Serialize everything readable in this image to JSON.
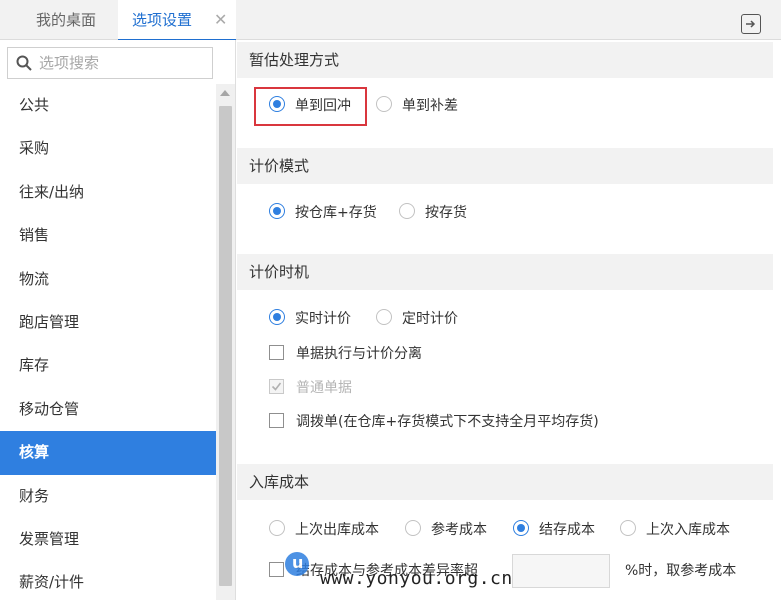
{
  "tabs": [
    {
      "label": "我的桌面"
    },
    {
      "label": "选项设置",
      "close": "✕"
    }
  ],
  "sidebar": {
    "search_placeholder": "选项搜索",
    "items": [
      {
        "label": "公共"
      },
      {
        "label": "采购"
      },
      {
        "label": "往来/出纳"
      },
      {
        "label": "销售"
      },
      {
        "label": "物流"
      },
      {
        "label": "跑店管理"
      },
      {
        "label": "库存"
      },
      {
        "label": "移动仓管"
      },
      {
        "label": "核算",
        "active": true
      },
      {
        "label": "财务"
      },
      {
        "label": "发票管理"
      },
      {
        "label": "薪资/计件"
      }
    ]
  },
  "sections": {
    "estimate": {
      "title": "暂估处理方式",
      "options": [
        {
          "label": "单到回冲",
          "checked": true
        },
        {
          "label": "单到补差",
          "checked": false
        }
      ]
    },
    "pricing_mode": {
      "title": "计价模式",
      "options": [
        {
          "label": "按仓库+存货",
          "checked": true
        },
        {
          "label": "按存货",
          "checked": false
        }
      ]
    },
    "pricing_timing": {
      "title": "计价时机",
      "options": [
        {
          "label": "实时计价",
          "checked": true
        },
        {
          "label": "定时计价",
          "checked": false
        }
      ],
      "checkboxes": [
        {
          "label": "单据执行与计价分离",
          "checked": false
        },
        {
          "label": "普通单据",
          "checked": true,
          "disabled": true
        },
        {
          "label": "调拨单(在仓库+存货模式下不支持全月平均存货)",
          "checked": false
        }
      ]
    },
    "inbound_cost": {
      "title": "入库成本",
      "options": [
        {
          "label": "上次出库成本",
          "checked": false
        },
        {
          "label": "参考成本",
          "checked": false
        },
        {
          "label": "结存成本",
          "checked": true
        },
        {
          "label": "上次入库成本",
          "checked": false
        }
      ],
      "ratio_prefix": "结存成本与参考成本差异率超",
      "ratio_suffix": "%时，取参考成本"
    }
  },
  "watermark": {
    "text": "www.yonyou.org.cn"
  },
  "colors": {
    "accent": "#2f7fe0",
    "highlight": "#d9363e"
  },
  "icons": {
    "search": "search-icon",
    "exit": "exit-icon",
    "close": "close-icon"
  }
}
